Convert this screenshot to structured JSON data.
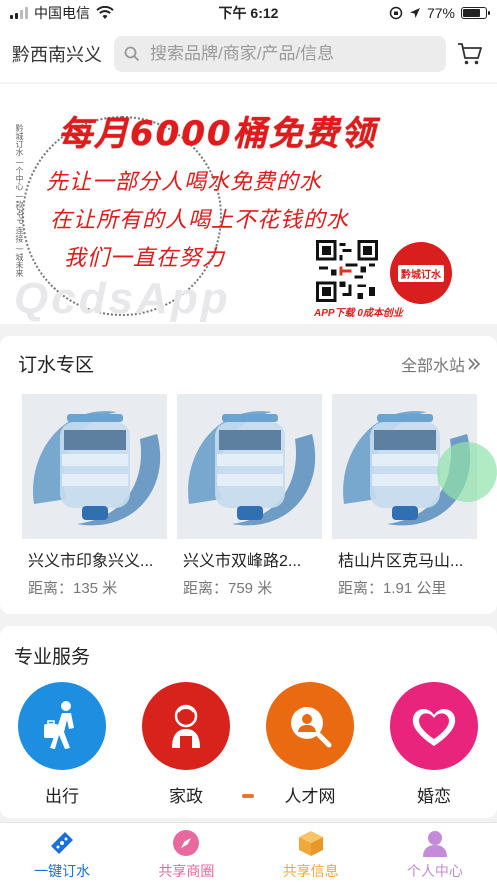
{
  "status_bar": {
    "carrier": "中国电信",
    "time": "下午 6:12",
    "battery_text": "77%",
    "battery_level": 0.77
  },
  "header": {
    "city": "黔西南兴义",
    "search_placeholder": "搜索品牌/商家/产品/信息"
  },
  "banner": {
    "title": "每月6000桶免费领",
    "line1": "先让一部分人喝水免费的水",
    "line2": "在让所有的人喝上不花钱的水",
    "line3": "我们一直在努力",
    "side_text": "黔城订水 一个中心 一款APP 连接 一城未来",
    "watermark": "QcdsApp",
    "logo_text": "黔城订水",
    "caption": "APP下载   0成本创业"
  },
  "water_section": {
    "title": "订水专区",
    "all_link": "全部水站",
    "stations": [
      {
        "name": "兴义市印象兴义...",
        "distance": "距离：135 米"
      },
      {
        "name": "兴义市双峰路2...",
        "distance": "距离：759 米"
      },
      {
        "name": "桔山片区克马山...",
        "distance": "距离：1.91 公里"
      }
    ]
  },
  "services": {
    "title": "专业服务",
    "items": [
      {
        "label": "出行",
        "color": "#1e8fe0"
      },
      {
        "label": "家政",
        "color": "#d8231c"
      },
      {
        "label": "人才网",
        "color": "#ea6a12"
      },
      {
        "label": "婚恋",
        "color": "#e8247c"
      }
    ]
  },
  "tabbar": {
    "items": [
      {
        "label": "一键订水",
        "color": "#1a6fd8"
      },
      {
        "label": "共享商圈",
        "color": "#e66aa0"
      },
      {
        "label": "共享信息",
        "color": "#f0a83a"
      },
      {
        "label": "个人中心",
        "color": "#c58ad8"
      }
    ]
  }
}
